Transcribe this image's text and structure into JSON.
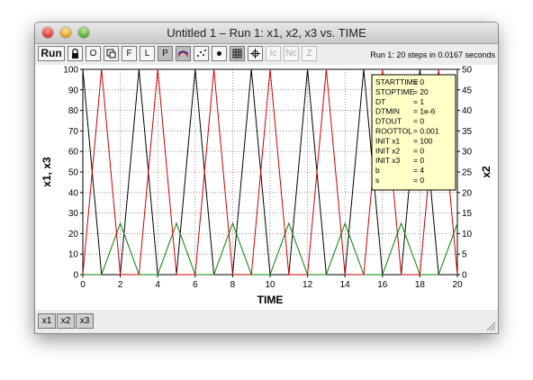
{
  "window": {
    "title": "Untitled 1 – Run 1: x1, x2, x3 vs. TIME"
  },
  "toolbar": {
    "run_label": "Run",
    "buttons": [
      "O",
      "F",
      "L",
      "P",
      "Ic",
      "Nc",
      "Z"
    ],
    "icons": [
      "lock-icon",
      "overlay-icon",
      "curves-icon",
      "scatter-icon",
      "dot-icon",
      "grid-icon",
      "crosshair-icon"
    ],
    "status": "Run 1: 20 steps in 0.0167 seconds"
  },
  "params": [
    {
      "name": "STARTTIME",
      "value": "= 0"
    },
    {
      "name": "STOPTIME",
      "value": "= 20"
    },
    {
      "name": "DT",
      "value": "= 1"
    },
    {
      "name": "DTMIN",
      "value": "= 1e-6"
    },
    {
      "name": "DTOUT",
      "value": "= 0"
    },
    {
      "name": "ROOTTOL",
      "value": "= 0.001"
    },
    {
      "name": "INIT x1",
      "value": "= 100"
    },
    {
      "name": "INIT x2",
      "value": "= 0"
    },
    {
      "name": "INIT x3",
      "value": "= 0"
    },
    {
      "name": "b",
      "value": "= 4"
    },
    {
      "name": "s",
      "value": "= 0"
    }
  ],
  "variable_buttons": [
    "x1",
    "x2",
    "x3"
  ],
  "colors": {
    "x1": "#000000",
    "x2": "#008000",
    "x3": "#cc0000",
    "param_box": "#ffffc8"
  },
  "chart_data": {
    "type": "line",
    "xlabel": "TIME",
    "ylabel_left": "x1, x3",
    "ylabel_right": "x2",
    "xlim": [
      0,
      20
    ],
    "ylim_left": [
      0,
      100
    ],
    "ylim_right": [
      0,
      50
    ],
    "x_ticks": [
      0,
      2,
      4,
      6,
      8,
      10,
      12,
      14,
      16,
      18,
      20
    ],
    "y_ticks_left": [
      0,
      10,
      20,
      30,
      40,
      50,
      60,
      70,
      80,
      90,
      100
    ],
    "y_ticks_right": [
      0,
      5,
      10,
      15,
      20,
      25,
      30,
      35,
      40,
      45,
      50
    ],
    "grid": true,
    "x": [
      0,
      1,
      2,
      3,
      4,
      5,
      6,
      7,
      8,
      9,
      10,
      11,
      12,
      13,
      14,
      15,
      16,
      17,
      18,
      19,
      20
    ],
    "series": [
      {
        "name": "x1",
        "axis": "left",
        "color": "#000000",
        "values": [
          100,
          0,
          0,
          100,
          0,
          0,
          100,
          0,
          0,
          100,
          0,
          0,
          100,
          0,
          0,
          100,
          0,
          0,
          100,
          0,
          0
        ]
      },
      {
        "name": "x2",
        "axis": "right",
        "color": "#008000",
        "values": [
          0,
          0,
          12.5,
          0,
          0,
          12.5,
          0,
          0,
          12.5,
          0,
          0,
          12.5,
          0,
          0,
          12.5,
          0,
          0,
          12.5,
          0,
          0,
          12.5
        ]
      },
      {
        "name": "x3",
        "axis": "left",
        "color": "#cc0000",
        "values": [
          0,
          100,
          0,
          0,
          100,
          0,
          0,
          100,
          0,
          0,
          100,
          0,
          0,
          100,
          0,
          0,
          100,
          0,
          0,
          100,
          0
        ]
      }
    ]
  }
}
